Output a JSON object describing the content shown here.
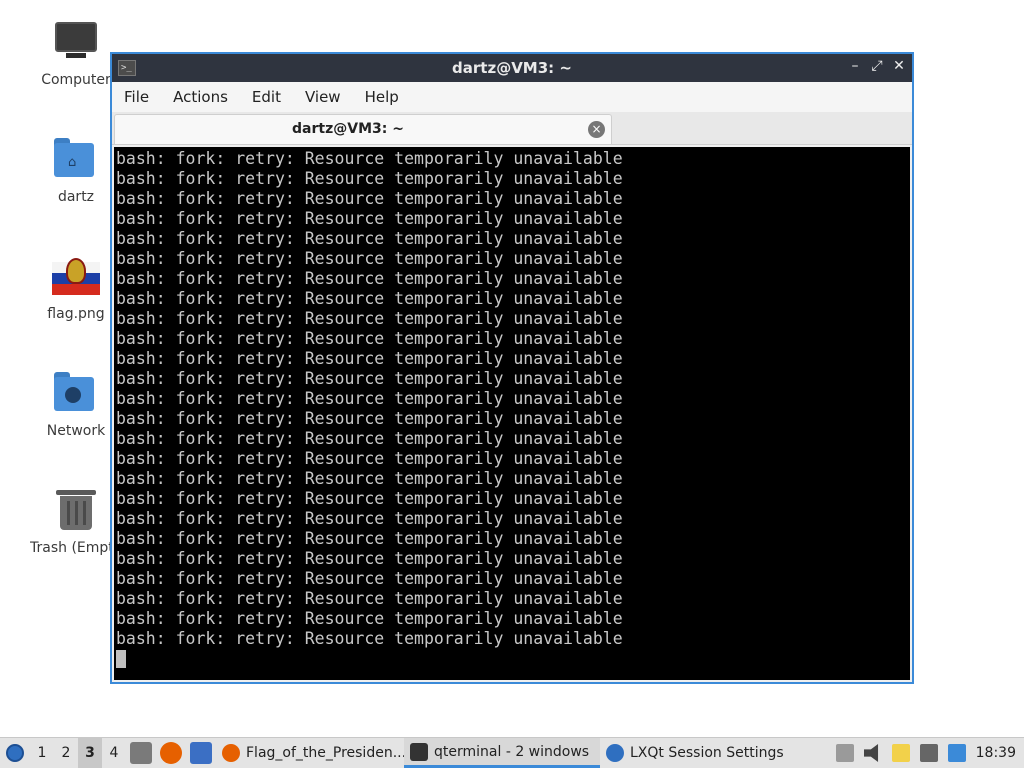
{
  "desktop": {
    "icons": [
      {
        "label": "Computer"
      },
      {
        "label": "dartz"
      },
      {
        "label": "flag.png"
      },
      {
        "label": "Network"
      },
      {
        "label": "Trash (Empty)"
      }
    ]
  },
  "window": {
    "title": "dartz@VM3: ~",
    "controls": {
      "minimize": "–",
      "maximize": "⤢",
      "close": "✕"
    },
    "menu": [
      "File",
      "Actions",
      "Edit",
      "View",
      "Help"
    ],
    "tab": {
      "label": "dartz@VM3: ~",
      "close": "×"
    },
    "terminal_lines": [
      "bash: fork: retry: Resource temporarily unavailable",
      "bash: fork: retry: Resource temporarily unavailable",
      "bash: fork: retry: Resource temporarily unavailable",
      "bash: fork: retry: Resource temporarily unavailable",
      "bash: fork: retry: Resource temporarily unavailable",
      "bash: fork: retry: Resource temporarily unavailable",
      "bash: fork: retry: Resource temporarily unavailable",
      "bash: fork: retry: Resource temporarily unavailable",
      "bash: fork: retry: Resource temporarily unavailable",
      "bash: fork: retry: Resource temporarily unavailable",
      "bash: fork: retry: Resource temporarily unavailable",
      "bash: fork: retry: Resource temporarily unavailable",
      "bash: fork: retry: Resource temporarily unavailable",
      "bash: fork: retry: Resource temporarily unavailable",
      "bash: fork: retry: Resource temporarily unavailable",
      "bash: fork: retry: Resource temporarily unavailable",
      "bash: fork: retry: Resource temporarily unavailable",
      "bash: fork: retry: Resource temporarily unavailable",
      "bash: fork: retry: Resource temporarily unavailable",
      "bash: fork: retry: Resource temporarily unavailable",
      "bash: fork: retry: Resource temporarily unavailable",
      "bash: fork: retry: Resource temporarily unavailable",
      "bash: fork: retry: Resource temporarily unavailable",
      "bash: fork: retry: Resource temporarily unavailable",
      "bash: fork: retry: Resource temporarily unavailable"
    ]
  },
  "taskbar": {
    "desktops": [
      "1",
      "2",
      "3",
      "4"
    ],
    "active_desktop": "3",
    "tasks": [
      {
        "label": "Flag_of_the_Presiden...",
        "icon": "firefox-icon"
      },
      {
        "label": "qterminal - 2 windows",
        "icon": "terminal-icon"
      },
      {
        "label": "LXQt Session Settings",
        "icon": "lxqt-icon"
      }
    ],
    "clock": "18:39"
  },
  "colors": {
    "accent": "#3b8ad8",
    "titlebar": "#2f343f",
    "terminal_bg": "#000000",
    "terminal_fg": "#c8c8c8"
  }
}
